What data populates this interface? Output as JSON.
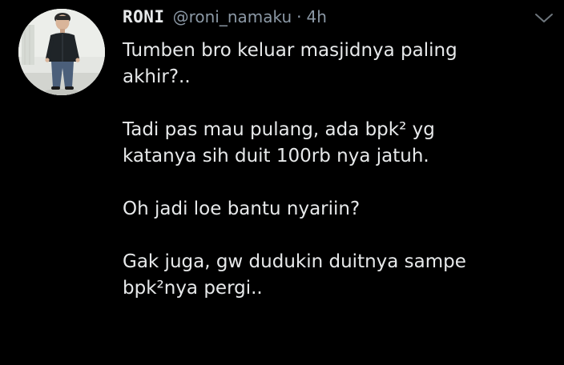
{
  "tweet": {
    "author_name": "RONI",
    "handle": "@roni_namaku",
    "separator": "·",
    "time": "4h",
    "menu_icon": "chevron-down-icon",
    "avatar_icon": "avatar-3d-character",
    "paragraphs": [
      "Tumben bro keluar masjidnya paling\nakhir?..",
      "Tadi pas mau pulang, ada bpk² yg\nkatanya sih duit 100rb nya jatuh.",
      "Oh jadi loe bantu nyariin?",
      "Gak juga, gw dudukin duitnya sampe\nbpk²nya pergi.."
    ]
  },
  "colors": {
    "background": "#000000",
    "text": "#e7e9ea",
    "secondary": "#8b98a5"
  }
}
